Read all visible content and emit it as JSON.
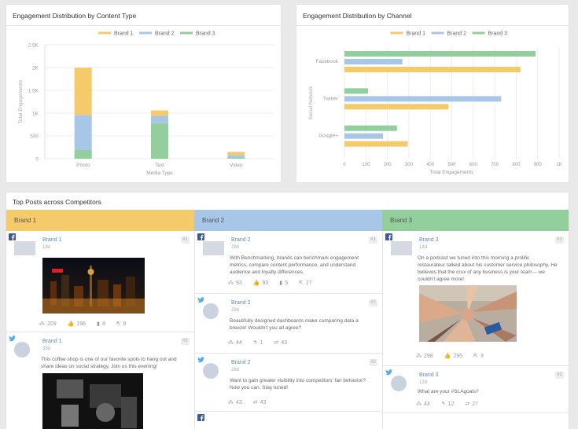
{
  "content_chart": {
    "title": "Engagement Distribution by Content Type",
    "chart_data": {
      "type": "bar",
      "stacked": true,
      "categories": [
        "Photo",
        "Text",
        "Video"
      ],
      "series": [
        {
          "name": "Brand 1",
          "color": "#f5ca6b",
          "values": [
            1040,
            120,
            70
          ]
        },
        {
          "name": "Brand 2",
          "color": "#a8c6e8",
          "values": [
            770,
            160,
            50
          ]
        },
        {
          "name": "Brand 3",
          "color": "#92cf9c",
          "values": [
            190,
            780,
            30
          ]
        }
      ],
      "xlabel": "Media Type",
      "ylabel": "Total Engagements",
      "ylim": [
        0,
        2500
      ],
      "yticks": [
        "0",
        "500",
        "1K",
        "1.5K",
        "2K",
        "2.5K"
      ],
      "grid": true,
      "legend": "top"
    }
  },
  "channel_chart": {
    "title": "Engagement Distribution by Channel",
    "chart_data": {
      "type": "bar",
      "orientation": "horizontal",
      "categories": [
        "Facebook",
        "Twitter",
        "Google+"
      ],
      "series": [
        {
          "name": "Brand 1",
          "color": "#f5ca6b",
          "values": [
            820,
            485,
            295
          ]
        },
        {
          "name": "Brand 2",
          "color": "#a8c6e8",
          "values": [
            270,
            730,
            180
          ]
        },
        {
          "name": "Brand 3",
          "color": "#92cf9c",
          "values": [
            890,
            110,
            245
          ]
        }
      ],
      "xlabel": "Total Engagements",
      "ylabel": "Social Network",
      "xlim": [
        0,
        1000
      ],
      "xticks": [
        "0",
        "100",
        "200",
        "300",
        "400",
        "500",
        "600",
        "700",
        "800",
        "900",
        "1K"
      ],
      "grid": true,
      "legend": "top"
    }
  },
  "top_posts": {
    "title": "Top Posts across Competitors",
    "columns": [
      {
        "name": "Brand 1",
        "color": "#f5ca6b",
        "posts": [
          {
            "network": "facebook",
            "rank": "#1",
            "author": "Brand 1",
            "age": "19d",
            "text": "",
            "stats": [
              "209",
              "196",
              "4",
              "9"
            ]
          },
          {
            "network": "twitter",
            "rank": "#2",
            "author": "Brand 1",
            "age": "35d",
            "text": "This coffee shop is one of our favorite spots to hang out and share ideas on social strategy. Join us this evening!",
            "stats": []
          }
        ]
      },
      {
        "name": "Brand 2",
        "color": "#a8c6e8",
        "posts": [
          {
            "network": "facebook",
            "rank": "#1",
            "author": "Brand 2",
            "age": "29d",
            "text": "With Benchmarking, brands can benchmark engagement metrics, compare content performance, and understand audience and loyalty differences.",
            "stats": [
              "93",
              "93",
              "5",
              "27"
            ]
          },
          {
            "network": "twitter",
            "rank": "#2",
            "author": "Brand 2",
            "age": "29d",
            "text": "Beautifully designed dashboards make comparing data a breeze! Wouldn't you all agree?",
            "stats": [
              "44",
              "1",
              "43"
            ]
          },
          {
            "network": "twitter",
            "rank": "#2",
            "author": "Brand 2",
            "age": "28d",
            "text": "Want to gain greater visibility into competitors' fan behavior? Now you can. Stay tuned!",
            "stats": [
              "43",
              "43"
            ]
          }
        ]
      },
      {
        "name": "Brand 3",
        "color": "#92cf9c",
        "posts": [
          {
            "network": "facebook",
            "rank": "#1",
            "author": "Brand 3",
            "age": "14d",
            "text": "On a podcast we tuned into this morning a prolific restaurateur talked about his customer service philosophy. He believes that the crux of any business is your team -- we couldn't agree more!",
            "stats": [
              "298",
              "295",
              "3"
            ]
          },
          {
            "network": "twitter",
            "rank": "#2",
            "author": "Brand 3",
            "age": "12d",
            "text": "What are your #SLAgoals?",
            "stats": [
              "43",
              "12",
              "27"
            ]
          }
        ]
      }
    ]
  }
}
